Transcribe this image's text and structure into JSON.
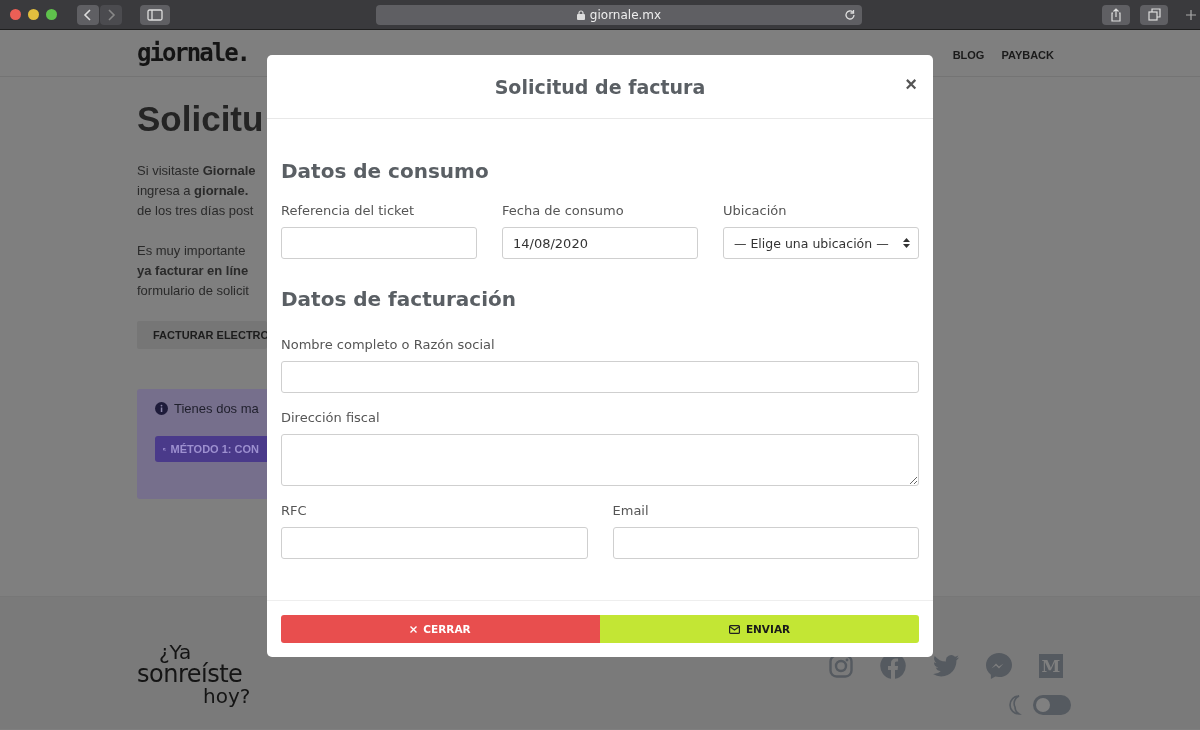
{
  "browser": {
    "url": "giornale.mx"
  },
  "site": {
    "logo": "giornale.",
    "nav": [
      "BLOG",
      "PAYBACK"
    ],
    "heading": "Solicitu",
    "paragraphs": [
      [
        "Si visitaste **Giornale**",
        "ingresa a **giornale.**",
        "de los tres días post"
      ],
      [
        "Es muy importante",
        "**ya facturar en líne**",
        "formulario de solicit"
      ]
    ],
    "invoice_button": "FACTURAR ELECTRO",
    "notice": {
      "text": "Tienes dos ma",
      "button": "MÉTODO 1: CON"
    }
  },
  "footer": {
    "slogan": [
      "¿Ya",
      "sonreíste",
      "hoy?"
    ],
    "social": [
      {
        "kind": "instagram"
      },
      {
        "kind": "facebook"
      },
      {
        "kind": "twitter"
      },
      {
        "kind": "messenger"
      },
      {
        "kind": "medium",
        "glyph": "M"
      }
    ],
    "dark_mode": {
      "on": false
    }
  },
  "modal": {
    "title": "Solicitud de factura",
    "close": "×",
    "sections": [
      {
        "title": "Datos de consumo",
        "rows": [
          [
            {
              "label": "Referencia del ticket",
              "kind": "text"
            },
            {
              "label": "Fecha de consumo",
              "kind": "text",
              "value": "14/08/2020"
            },
            {
              "label": "Ubicación",
              "kind": "select",
              "value": "— Elige una ubicación —"
            }
          ]
        ]
      },
      {
        "title": "Datos de facturación",
        "rows": [
          [
            {
              "label": "Nombre completo o Razón social",
              "kind": "text"
            }
          ],
          [
            {
              "label": "Dirección fiscal",
              "kind": "textarea"
            }
          ],
          [
            {
              "label": "RFC",
              "kind": "text"
            },
            {
              "label": "Email",
              "kind": "text"
            }
          ]
        ]
      }
    ],
    "buttons": [
      {
        "label": "CERRAR",
        "kind": "close"
      },
      {
        "label": "ENVIAR",
        "kind": "send"
      }
    ]
  }
}
